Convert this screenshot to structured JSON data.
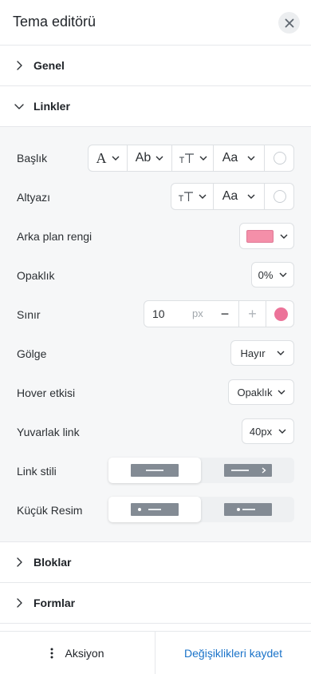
{
  "header": {
    "title": "Tema editörü"
  },
  "sections": {
    "genel": "Genel",
    "linkler": "Linkler",
    "bloklar": "Bloklar",
    "formlar": "Formlar"
  },
  "rows": {
    "baslik": "Başlık",
    "altyazi": "Altyazı",
    "arka_plan": "Arka plan rengi",
    "opaklik": "Opaklık",
    "sinir": "Sınır",
    "golge": "Gölge",
    "hover": "Hover etkisi",
    "yuvarlak": "Yuvarlak link",
    "link_stili": "Link stili",
    "kucuk_resim": "Küçük Resim"
  },
  "controls": {
    "font_glyph": "A",
    "style_glyph": "Ab",
    "size_glyph": "TT",
    "case_glyph": "Aa",
    "opaklik_value": "0%",
    "sinir_value": "10",
    "sinir_unit": "px",
    "minus": "−",
    "plus": "+",
    "golge_value": "Hayır",
    "hover_value": "Opaklık",
    "yuvarlak_value": "40px"
  },
  "colors": {
    "background_swatch": "#f48fa9",
    "border_color": "#ec7399",
    "accent": "#1a73c9"
  },
  "icons": {
    "close": "close-icon",
    "chevron_right": "chevron-right-icon",
    "chevron_down": "chevron-down-icon",
    "more": "more-vertical-icon"
  },
  "footer": {
    "action_label": "Aksiyon",
    "save_label": "Değişiklikleri kaydet"
  }
}
